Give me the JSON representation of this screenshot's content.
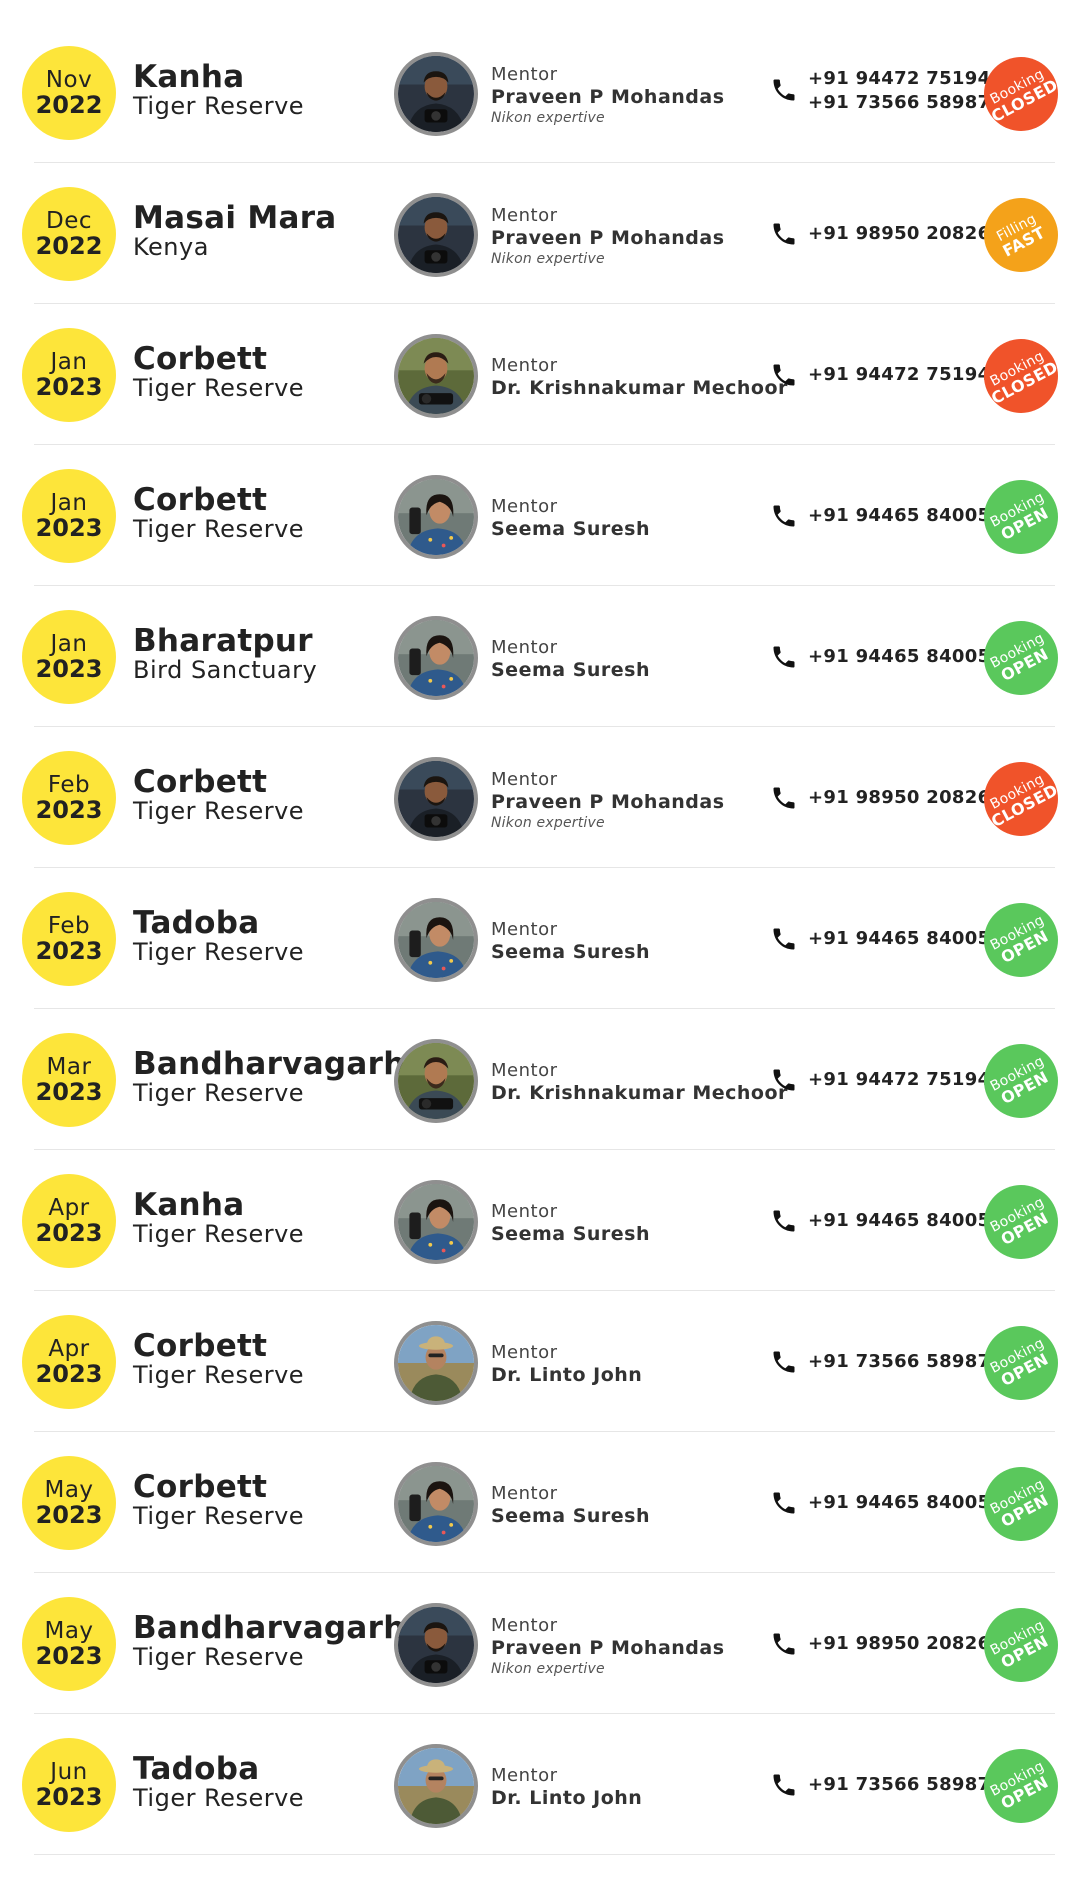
{
  "colors": {
    "date_circle": "#fde53a",
    "status_closed": "#f0532a",
    "status_open": "#5ac85c",
    "status_fast": "#f4a21a",
    "avatar_border": "#8f8f8f"
  },
  "mentor_label": "Mentor",
  "events": [
    {
      "month": "Nov",
      "year": "2022",
      "place": "Kanha",
      "place_sub": "Tiger Reserve",
      "mentor_name": "Praveen P Mohandas",
      "mentor_note": "Nikon expertive",
      "mentor_photo_icon": "mentor-praveen-photo",
      "phones": [
        "+91 94472 75194",
        "+91 73566 58987"
      ],
      "status_top": "Booking",
      "status_bottom": "CLOSED",
      "status_kind": "closed"
    },
    {
      "month": "Dec",
      "year": "2022",
      "place": "Masai Mara",
      "place_sub": "Kenya",
      "mentor_name": "Praveen P Mohandas",
      "mentor_note": "Nikon expertive",
      "mentor_photo_icon": "mentor-praveen-photo",
      "phones": [
        "+91 98950 20826"
      ],
      "status_top": "Filling",
      "status_bottom": "FAST",
      "status_kind": "fast"
    },
    {
      "month": "Jan",
      "year": "2023",
      "place": "Corbett",
      "place_sub": "Tiger Reserve",
      "mentor_name": "Dr. Krishnakumar Mechoor",
      "mentor_note": "",
      "mentor_photo_icon": "mentor-krishnakumar-photo",
      "phones": [
        "+91 94472 75194"
      ],
      "status_top": "Booking",
      "status_bottom": "CLOSED",
      "status_kind": "closed"
    },
    {
      "month": "Jan",
      "year": "2023",
      "place": "Corbett",
      "place_sub": "Tiger Reserve",
      "mentor_name": "Seema Suresh",
      "mentor_note": "",
      "mentor_photo_icon": "mentor-seema-photo",
      "phones": [
        "+91 94465 84005"
      ],
      "status_top": "Booking",
      "status_bottom": "OPEN",
      "status_kind": "open"
    },
    {
      "month": "Jan",
      "year": "2023",
      "place": "Bharatpur",
      "place_sub": "Bird Sanctuary",
      "mentor_name": "Seema Suresh",
      "mentor_note": "",
      "mentor_photo_icon": "mentor-seema-photo",
      "phones": [
        "+91 94465 84005"
      ],
      "status_top": "Booking",
      "status_bottom": "OPEN",
      "status_kind": "open"
    },
    {
      "month": "Feb",
      "year": "2023",
      "place": "Corbett",
      "place_sub": "Tiger Reserve",
      "mentor_name": "Praveen P Mohandas",
      "mentor_note": "Nikon expertive",
      "mentor_photo_icon": "mentor-praveen-photo",
      "phones": [
        "+91 98950 20826"
      ],
      "status_top": "Booking",
      "status_bottom": "CLOSED",
      "status_kind": "closed"
    },
    {
      "month": "Feb",
      "year": "2023",
      "place": "Tadoba",
      "place_sub": "Tiger Reserve",
      "mentor_name": "Seema Suresh",
      "mentor_note": "",
      "mentor_photo_icon": "mentor-seema-photo",
      "phones": [
        "+91 94465 84005"
      ],
      "status_top": "Booking",
      "status_bottom": "OPEN",
      "status_kind": "open"
    },
    {
      "month": "Mar",
      "year": "2023",
      "place": "Bandharvagarh",
      "place_sub": "Tiger Reserve",
      "mentor_name": "Dr. Krishnakumar Mechoor",
      "mentor_note": "",
      "mentor_photo_icon": "mentor-krishnakumar-photo",
      "phones": [
        "+91 94472 75194"
      ],
      "status_top": "Booking",
      "status_bottom": "OPEN",
      "status_kind": "open"
    },
    {
      "month": "Apr",
      "year": "2023",
      "place": "Kanha",
      "place_sub": "Tiger Reserve",
      "mentor_name": "Seema Suresh",
      "mentor_note": "",
      "mentor_photo_icon": "mentor-seema-photo",
      "phones": [
        "+91 94465 84005"
      ],
      "status_top": "Booking",
      "status_bottom": "OPEN",
      "status_kind": "open"
    },
    {
      "month": "Apr",
      "year": "2023",
      "place": "Corbett",
      "place_sub": "Tiger Reserve",
      "mentor_name": "Dr. Linto John",
      "mentor_note": "",
      "mentor_photo_icon": "mentor-linto-photo",
      "phones": [
        "+91 73566 58987"
      ],
      "status_top": "Booking",
      "status_bottom": "OPEN",
      "status_kind": "open"
    },
    {
      "month": "May",
      "year": "2023",
      "place": "Corbett",
      "place_sub": "Tiger Reserve",
      "mentor_name": "Seema Suresh",
      "mentor_note": "",
      "mentor_photo_icon": "mentor-seema-photo",
      "phones": [
        "+91 94465 84005"
      ],
      "status_top": "Booking",
      "status_bottom": "OPEN",
      "status_kind": "open"
    },
    {
      "month": "May",
      "year": "2023",
      "place": "Bandharvagarh",
      "place_sub": "Tiger Reserve",
      "mentor_name": "Praveen P Mohandas",
      "mentor_note": "Nikon expertive",
      "mentor_photo_icon": "mentor-praveen-photo",
      "phones": [
        "+91 98950 20826"
      ],
      "status_top": "Booking",
      "status_bottom": "OPEN",
      "status_kind": "open"
    },
    {
      "month": "Jun",
      "year": "2023",
      "place": "Tadoba",
      "place_sub": "Tiger Reserve",
      "mentor_name": "Dr. Linto John",
      "mentor_note": "",
      "mentor_photo_icon": "mentor-linto-photo",
      "phones": [
        "+91 73566 58987"
      ],
      "status_top": "Booking",
      "status_bottom": "OPEN",
      "status_kind": "open"
    }
  ]
}
